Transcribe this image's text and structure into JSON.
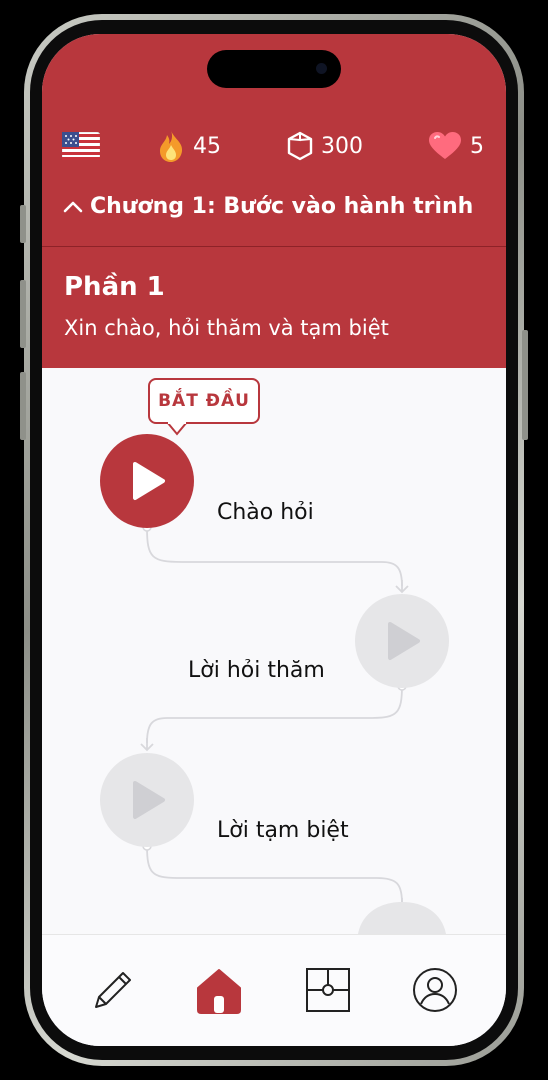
{
  "stats": {
    "language_flag": "us-flag-icon",
    "streak": "45",
    "gems": "300",
    "hearts": "5"
  },
  "chapter": {
    "title": "Chương 1: Bước vào hành trình"
  },
  "section": {
    "title": "Phần 1",
    "subtitle": "Xin chào, hỏi thăm và tạm biệt"
  },
  "start_bubble": "BẮT ĐẦU",
  "lessons": [
    {
      "label": "Chào hỏi",
      "state": "active"
    },
    {
      "label": "Lời hỏi thăm",
      "state": "locked"
    },
    {
      "label": "Lời tạm biệt",
      "state": "locked"
    }
  ],
  "nav": [
    {
      "icon": "pencil-icon"
    },
    {
      "icon": "home-icon",
      "active": true
    },
    {
      "icon": "board-icon"
    },
    {
      "icon": "profile-icon"
    }
  ],
  "colors": {
    "brand": "#b8373d",
    "locked": "#e6e6e8"
  }
}
